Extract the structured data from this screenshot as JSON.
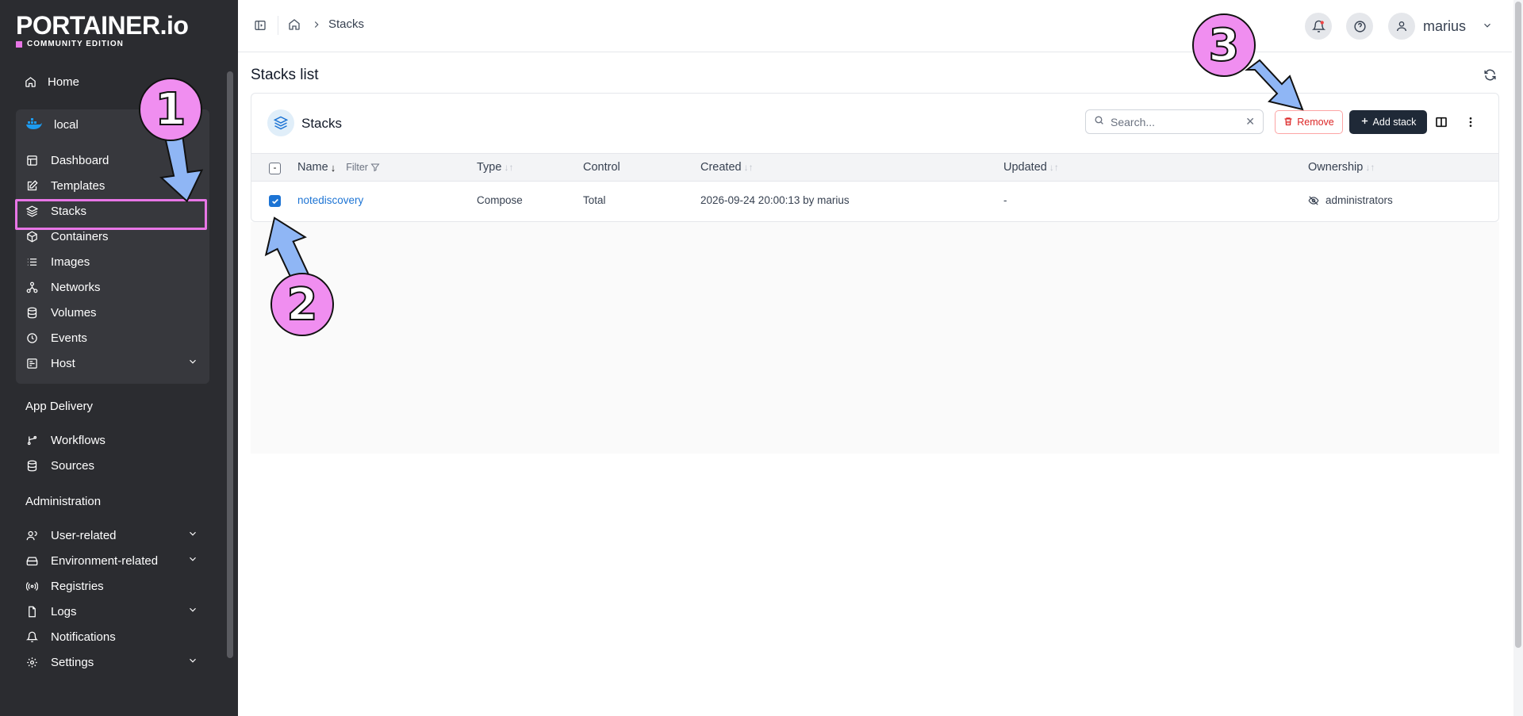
{
  "sidebar": {
    "logo_main": "PORTAINER.io",
    "logo_sub": "COMMUNITY EDITION",
    "home": "Home",
    "environment": "local",
    "env_items": [
      "Dashboard",
      "Templates",
      "Stacks",
      "Containers",
      "Images",
      "Networks",
      "Volumes",
      "Events",
      "Host"
    ],
    "app_delivery_title": "App Delivery",
    "app_delivery_items": [
      "Workflows",
      "Sources"
    ],
    "administration_title": "Administration",
    "admin_items": [
      "User-related",
      "Environment-related",
      "Registries",
      "Logs",
      "Notifications",
      "Settings"
    ]
  },
  "topbar": {
    "breadcrumb": "Stacks",
    "username": "marius"
  },
  "page": {
    "title": "Stacks list"
  },
  "card": {
    "title": "Stacks",
    "search_placeholder": "Search...",
    "remove_label": "Remove",
    "add_label": "Add stack"
  },
  "table": {
    "headers": {
      "name": "Name",
      "filter": "Filter",
      "type": "Type",
      "control": "Control",
      "created": "Created",
      "updated": "Updated",
      "ownership": "Ownership"
    },
    "rows": [
      {
        "name": "notediscovery",
        "type": "Compose",
        "control": "Total",
        "created": "2026-09-24 20:00:13 by marius",
        "updated": "-",
        "ownership": "administrators"
      }
    ]
  },
  "annotations": [
    "1",
    "2",
    "3"
  ],
  "colors": {
    "sidebar_bg": "#2b2c30",
    "accent_pink": "#e876e6",
    "link_blue": "#1d74d4",
    "danger_red": "#dc2626"
  }
}
